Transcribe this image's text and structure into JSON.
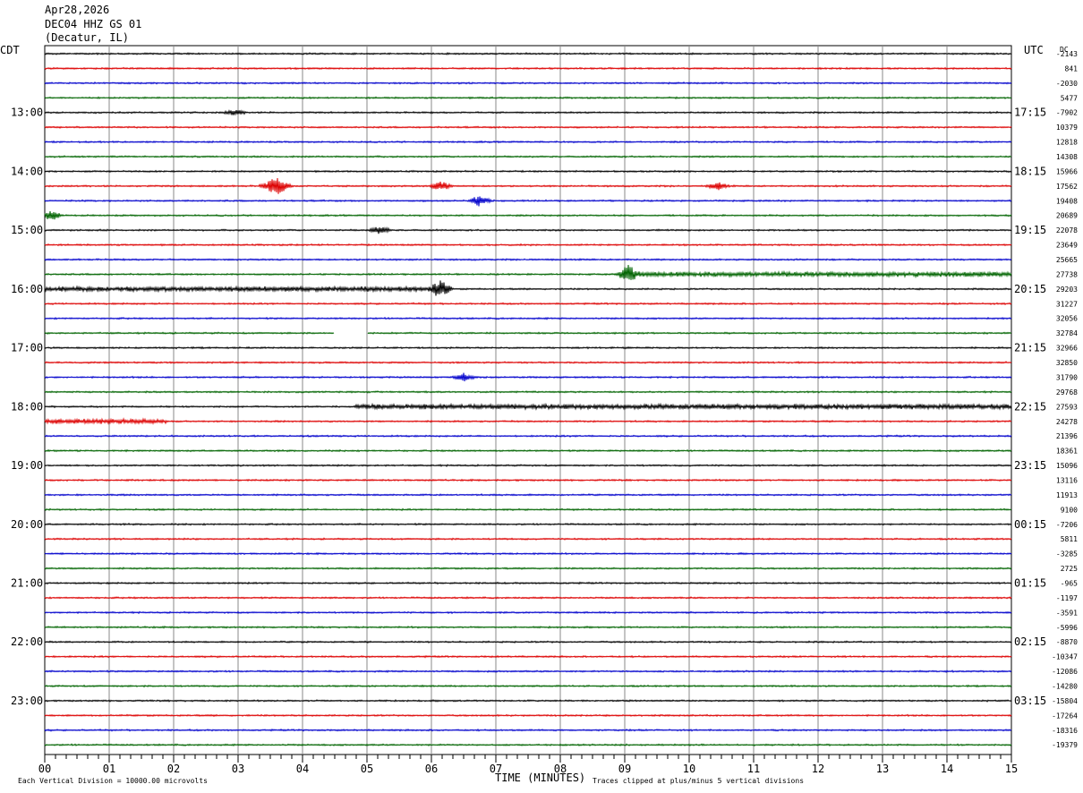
{
  "header": {
    "date": "Apr28,2026",
    "station": "DEC04 HHZ GS 01",
    "location": "(Decatur, IL)"
  },
  "left_zone": "CDT",
  "right_zone": "UTC",
  "dc_label": "DC",
  "colors": [
    "#000000",
    "#dd0000",
    "#0000cc",
    "#006400"
  ],
  "footer": {
    "scale_note": "Each Vertical Division = 10000.00 microvolts",
    "xlabel": "TIME (MINUTES)",
    "clip_note": "Traces clipped at plus/minus 5 vertical divisions"
  },
  "chart_data": {
    "type": "line",
    "title": "DEC04 HHZ GS 01",
    "xlabel": "TIME (MINUTES)",
    "ylabel": "",
    "xlim": [
      0,
      15
    ],
    "x_ticks": [
      "00",
      "01",
      "02",
      "03",
      "04",
      "05",
      "06",
      "07",
      "08",
      "09",
      "10",
      "11",
      "12",
      "13",
      "14",
      "15"
    ],
    "left_hour_labels": [
      "13:00",
      "14:00",
      "15:00",
      "16:00",
      "17:00",
      "18:00",
      "19:00",
      "20:00",
      "21:00",
      "22:00",
      "23:00"
    ],
    "right_hour_labels": [
      "17:15",
      "18:15",
      "19:15",
      "20:15",
      "21:15",
      "22:15",
      "23:15",
      "00:15",
      "01:15",
      "02:15",
      "03:15"
    ],
    "trace_count": 48,
    "dc_offsets": [
      "-2143",
      "841",
      "-2030",
      "5477",
      "-7902",
      "10379",
      "12818",
      "14308",
      "15966",
      "17562",
      "19408",
      "20689",
      "22078",
      "23649",
      "25665",
      "27738",
      "29203",
      "31227",
      "32056",
      "32784",
      "32966",
      "32850",
      "31790",
      "29768",
      "27593",
      "24278",
      "21396",
      "18361",
      "15096",
      "13116",
      "11913",
      "9100",
      "-7206",
      "5811",
      "-3285",
      "2725",
      "-965",
      "-1197",
      "-3591",
      "-5996",
      "-8870",
      "-10347",
      "-12086",
      "-14280",
      "-15804",
      "-17264",
      "-18316",
      "-19379"
    ],
    "events": [
      {
        "trace": 4,
        "minute": 2.95,
        "amp": 3
      },
      {
        "trace": 9,
        "minute": 3.5,
        "amp": 5
      },
      {
        "trace": 9,
        "minute": 3.65,
        "amp": 8
      },
      {
        "trace": 9,
        "minute": 6.15,
        "amp": 5
      },
      {
        "trace": 9,
        "minute": 10.45,
        "amp": 4
      },
      {
        "trace": 10,
        "minute": 6.75,
        "amp": 6
      },
      {
        "trace": 11,
        "minute": 0.1,
        "amp": 5
      },
      {
        "trace": 12,
        "minute": 5.2,
        "amp": 4
      },
      {
        "trace": 15,
        "minute": 9.05,
        "amp": 9
      },
      {
        "trace": 16,
        "minute": 6.15,
        "amp": 9
      },
      {
        "trace": 22,
        "minute": 6.5,
        "amp": 4
      }
    ],
    "noisy_segments": [
      {
        "trace": 15,
        "start": 9.0,
        "end": 15.0
      },
      {
        "trace": 16,
        "start": 0.0,
        "end": 6.1
      },
      {
        "trace": 24,
        "start": 4.8,
        "end": 15.0
      },
      {
        "trace": 25,
        "start": 0.0,
        "end": 1.9
      }
    ],
    "gaps": [
      {
        "trace": 19,
        "start": 4.5,
        "end": 5.0
      }
    ]
  }
}
